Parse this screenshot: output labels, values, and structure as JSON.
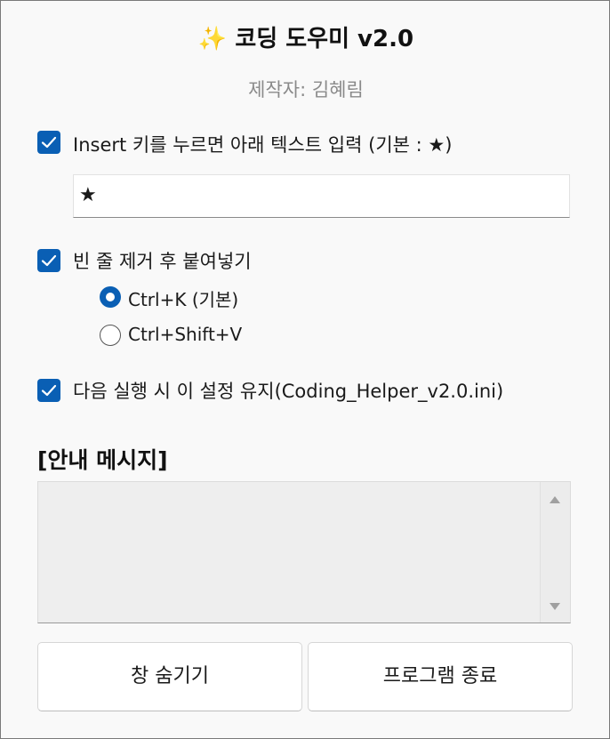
{
  "header": {
    "title": "✨ 코딩 도우미 v2.0",
    "author": "제작자: 김혜림"
  },
  "options": {
    "insert_text": {
      "checked": true,
      "label": "Insert 키를 누르면 아래 텍스트 입력 (기본 : ★)",
      "value": "★"
    },
    "remove_blank_lines": {
      "checked": true,
      "label": "빈 줄 제거 후 붙여넣기",
      "hotkeys": [
        {
          "label": "Ctrl+K (기본)",
          "selected": true
        },
        {
          "label": "Ctrl+Shift+V",
          "selected": false
        }
      ]
    },
    "keep_settings": {
      "checked": true,
      "label": "다음 실행 시 이 설정 유지(Coding_Helper_v2.0.ini)"
    }
  },
  "guide": {
    "heading": "[안내 메시지]",
    "message": ""
  },
  "buttons": {
    "hide": "창 숨기기",
    "exit": "프로그램 종료"
  },
  "colors": {
    "accent": "#0a5fb4",
    "background": "#f9f9f9",
    "author_text": "#8a8a8a"
  }
}
